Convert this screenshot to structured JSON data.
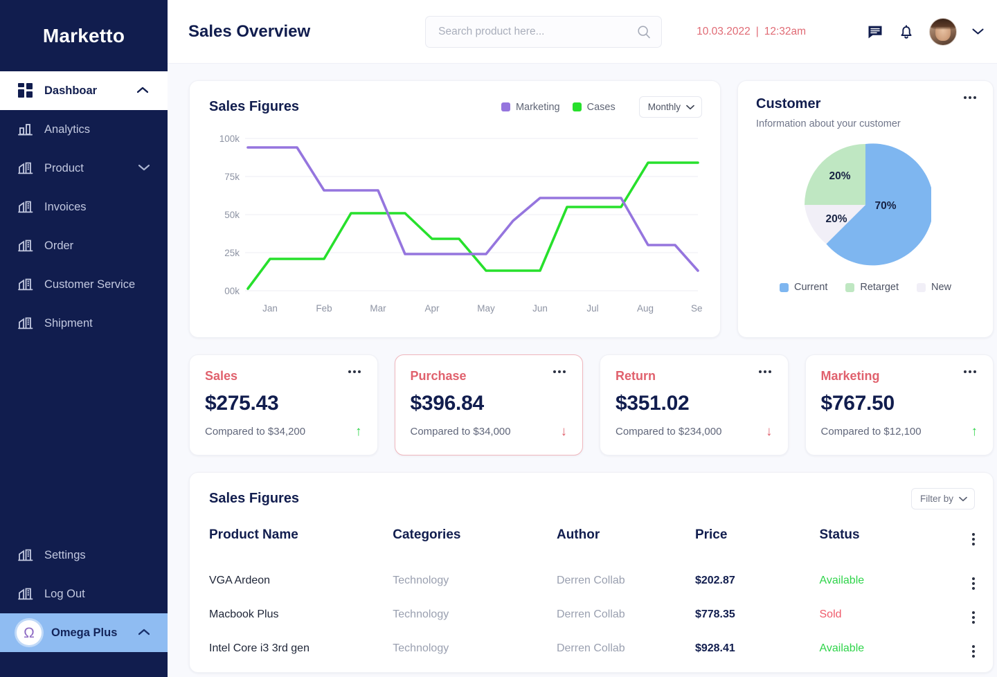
{
  "sidebar": {
    "brand": "Marketto",
    "items": [
      {
        "label": "Dashboar",
        "icon": "grid-icon",
        "active": true
      },
      {
        "label": "Analytics",
        "icon": "bar-chart-icon",
        "active": false
      },
      {
        "label": "Product",
        "icon": "building-icon",
        "active": false,
        "caret": "chevron-down-icon"
      },
      {
        "label": "Invoices",
        "icon": "building-icon",
        "active": false
      },
      {
        "label": "Order",
        "icon": "building-icon",
        "active": false
      },
      {
        "label": "Customer Service",
        "icon": "building-icon",
        "active": false
      },
      {
        "label": "Shipment",
        "icon": "building-icon",
        "active": false
      }
    ],
    "bottom_items": [
      {
        "label": "Settings",
        "icon": "building-icon"
      },
      {
        "label": "Log Out",
        "icon": "building-icon"
      }
    ],
    "account": {
      "label": "Omega Plus",
      "avatar_glyph": "Ω",
      "caret": "chevron-up-icon"
    },
    "colors": {
      "bg": "#111d4e",
      "active_bg": "#ffffff",
      "account_bg": "#8fbcf2"
    }
  },
  "header": {
    "title": "Sales Overview",
    "search": {
      "placeholder": "Search product here...",
      "value": ""
    },
    "date": "10.03.2022",
    "separator": "|",
    "time": "12:32am",
    "datetime_color": "#e06a74",
    "icons": [
      "message-icon",
      "bell-icon",
      "avatar",
      "chevron-down-icon"
    ]
  },
  "sales_figures_card": {
    "title": "Sales Figures",
    "period_selected": "Monthly",
    "legend": [
      {
        "label": "Marketing",
        "color": "#9575de"
      },
      {
        "label": "Cases",
        "color": "#27e02c"
      }
    ]
  },
  "customer_card": {
    "title": "Customer",
    "subtitle": "Information about your customer",
    "menu": "more-options-icon"
  },
  "stats": [
    {
      "label": "Sales",
      "value": "$275.43",
      "compared": "Compared to $34,200",
      "trend": "up",
      "selected": false
    },
    {
      "label": "Purchase",
      "value": "$396.84",
      "compared": "Compared to $34,000",
      "trend": "down",
      "selected": true
    },
    {
      "label": "Return",
      "value": "$351.02",
      "compared": "Compared to $234,000",
      "trend": "down",
      "selected": false
    },
    {
      "label": "Marketing",
      "value": "$767.50",
      "compared": "Compared to $12,100",
      "trend": "up",
      "selected": false
    }
  ],
  "table_card": {
    "title": "Sales Figures",
    "filter_label": "Filter by",
    "columns": [
      "Product Name",
      "Categories",
      "Author",
      "Price",
      "Status"
    ],
    "rows": [
      {
        "name": "VGA Ardeon",
        "category": "Technology",
        "author": "Derren Collab",
        "price": "$202.87",
        "status": "Available"
      },
      {
        "name": "Macbook Plus",
        "category": "Technology",
        "author": "Derren Collab",
        "price": "$778.35",
        "status": "Sold"
      },
      {
        "name": "Intel Core i3 3rd gen",
        "category": "Technology",
        "author": "Derren Collab",
        "price": "$928.41",
        "status": "Available"
      }
    ]
  },
  "chart_data": [
    {
      "type": "line",
      "title": "Sales Figures",
      "xlabel": "",
      "ylabel": "",
      "categories": [
        "Jan",
        "Feb",
        "Mar",
        "Apr",
        "May",
        "Jun",
        "Jul",
        "Aug",
        "Sep"
      ],
      "ytick_labels": [
        "00k",
        "25k",
        "50k",
        "75k",
        "100k"
      ],
      "ylim": [
        0,
        100000
      ],
      "grid": true,
      "legend_position": "top-right",
      "step_style": true,
      "series": [
        {
          "name": "Marketing",
          "color": "#9575de",
          "values": [
            94000,
            94000,
            66000,
            66000,
            24000,
            24000,
            46000,
            61000,
            61000,
            31000,
            31000,
            13000
          ]
        },
        {
          "name": "Cases",
          "color": "#27e02c",
          "values": [
            2000,
            21000,
            21000,
            51000,
            51000,
            34000,
            34000,
            13000,
            13000,
            55000,
            55000,
            84000,
            84000
          ]
        }
      ],
      "series_points": {
        "Marketing": [
          {
            "x": "Jan",
            "y": 94000
          },
          {
            "x": "Feb",
            "y": 94000
          },
          {
            "x": "Mar",
            "y": 66000
          },
          {
            "x": "Apr",
            "y": 66000
          },
          {
            "x": "May",
            "y": 24000
          },
          {
            "x": "Jun",
            "y": 24000
          },
          {
            "x": "Jun",
            "y": 46000
          },
          {
            "x": "Jul",
            "y": 61000
          },
          {
            "x": "Aug",
            "y": 61000
          },
          {
            "x": "Aug",
            "y": 31000
          },
          {
            "x": "Sep",
            "y": 31000
          },
          {
            "x": "Sep",
            "y": 13000
          }
        ],
        "Cases": [
          {
            "x": "Jan",
            "y": 2000
          },
          {
            "x": "Feb",
            "y": 21000
          },
          {
            "x": "Mar",
            "y": 21000
          },
          {
            "x": "Mar",
            "y": 51000
          },
          {
            "x": "Apr",
            "y": 51000
          },
          {
            "x": "May",
            "y": 34000
          },
          {
            "x": "May",
            "y": 34000
          },
          {
            "x": "Jun",
            "y": 13000
          },
          {
            "x": "Jul",
            "y": 13000
          },
          {
            "x": "Jul",
            "y": 55000
          },
          {
            "x": "Aug",
            "y": 55000
          },
          {
            "x": "Sep",
            "y": 84000
          }
        ]
      }
    },
    {
      "type": "pie",
      "title": "Customer",
      "subtitle": "Information about your customer",
      "labels": [
        "Current",
        "Retarget",
        "New"
      ],
      "values": [
        70,
        20,
        20
      ],
      "display_labels": [
        "70%",
        "20%",
        "20%"
      ],
      "colors": [
        "#7eb6f0",
        "#bfe7c2",
        "#f1eff7"
      ],
      "legend_position": "bottom",
      "slice_angles_deg": [
        220,
        90,
        50
      ]
    }
  ]
}
